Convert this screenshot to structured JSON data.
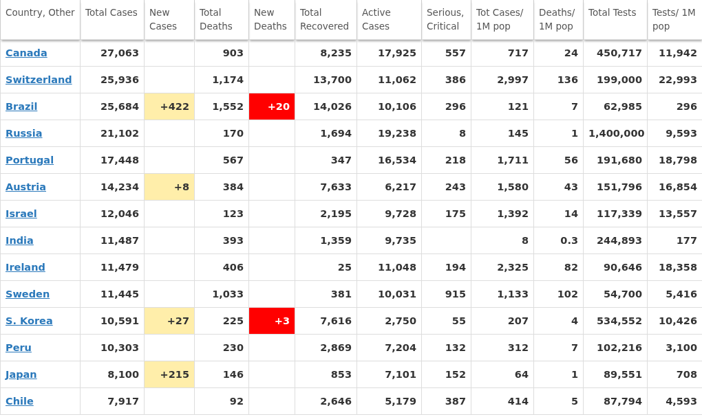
{
  "table": {
    "columns": [
      {
        "label": "Country, Other",
        "kind": "country"
      },
      {
        "label": "Total Cases",
        "kind": "number"
      },
      {
        "label": "New Cases",
        "kind": "new_cases"
      },
      {
        "label": "Total Deaths",
        "kind": "number"
      },
      {
        "label": "New Deaths",
        "kind": "new_deaths"
      },
      {
        "label": "Total Recovered",
        "kind": "number"
      },
      {
        "label": "Active Cases",
        "kind": "number"
      },
      {
        "label": "Serious, Critical",
        "kind": "number"
      },
      {
        "label": "Tot Cases/ 1M pop",
        "kind": "number"
      },
      {
        "label": "Deaths/ 1M pop",
        "kind": "number"
      },
      {
        "label": "Total Tests",
        "kind": "number"
      },
      {
        "label": "Tests/ 1M pop",
        "kind": "number"
      }
    ],
    "rows": [
      {
        "cells": [
          "Canada",
          "27,063",
          null,
          "903",
          null,
          "8,235",
          "17,925",
          "557",
          "717",
          "24",
          "450,717",
          "11,942"
        ]
      },
      {
        "cells": [
          "Switzerland",
          "25,936",
          null,
          "1,174",
          null,
          "13,700",
          "11,062",
          "386",
          "2,997",
          "136",
          "199,000",
          "22,993"
        ]
      },
      {
        "cells": [
          "Brazil",
          "25,684",
          "+422",
          "1,552",
          "+20",
          "14,026",
          "10,106",
          "296",
          "121",
          "7",
          "62,985",
          "296"
        ]
      },
      {
        "cells": [
          "Russia",
          "21,102",
          null,
          "170",
          null,
          "1,694",
          "19,238",
          "8",
          "145",
          "1",
          "1,400,000",
          "9,593"
        ]
      },
      {
        "cells": [
          "Portugal",
          "17,448",
          null,
          "567",
          null,
          "347",
          "16,534",
          "218",
          "1,711",
          "56",
          "191,680",
          "18,798"
        ]
      },
      {
        "cells": [
          "Austria",
          "14,234",
          "+8",
          "384",
          null,
          "7,633",
          "6,217",
          "243",
          "1,580",
          "43",
          "151,796",
          "16,854"
        ]
      },
      {
        "cells": [
          "Israel",
          "12,046",
          null,
          "123",
          null,
          "2,195",
          "9,728",
          "175",
          "1,392",
          "14",
          "117,339",
          "13,557"
        ]
      },
      {
        "cells": [
          "India",
          "11,487",
          null,
          "393",
          null,
          "1,359",
          "9,735",
          null,
          "8",
          "0.3",
          "244,893",
          "177"
        ]
      },
      {
        "cells": [
          "Ireland",
          "11,479",
          null,
          "406",
          null,
          "25",
          "11,048",
          "194",
          "2,325",
          "82",
          "90,646",
          "18,358"
        ]
      },
      {
        "cells": [
          "Sweden",
          "11,445",
          null,
          "1,033",
          null,
          "381",
          "10,031",
          "915",
          "1,133",
          "102",
          "54,700",
          "5,416"
        ]
      },
      {
        "cells": [
          "S. Korea",
          "10,591",
          "+27",
          "225",
          "+3",
          "7,616",
          "2,750",
          "55",
          "207",
          "4",
          "534,552",
          "10,426"
        ]
      },
      {
        "cells": [
          "Peru",
          "10,303",
          null,
          "230",
          null,
          "2,869",
          "7,204",
          "132",
          "312",
          "7",
          "102,216",
          "3,100"
        ]
      },
      {
        "cells": [
          "Japan",
          "8,100",
          "+215",
          "146",
          null,
          "853",
          "7,101",
          "152",
          "64",
          "1",
          "89,551",
          "708"
        ]
      },
      {
        "cells": [
          "Chile",
          "7,917",
          null,
          "92",
          null,
          "2,646",
          "5,179",
          "387",
          "414",
          "5",
          "87,794",
          "4,593"
        ]
      }
    ]
  }
}
